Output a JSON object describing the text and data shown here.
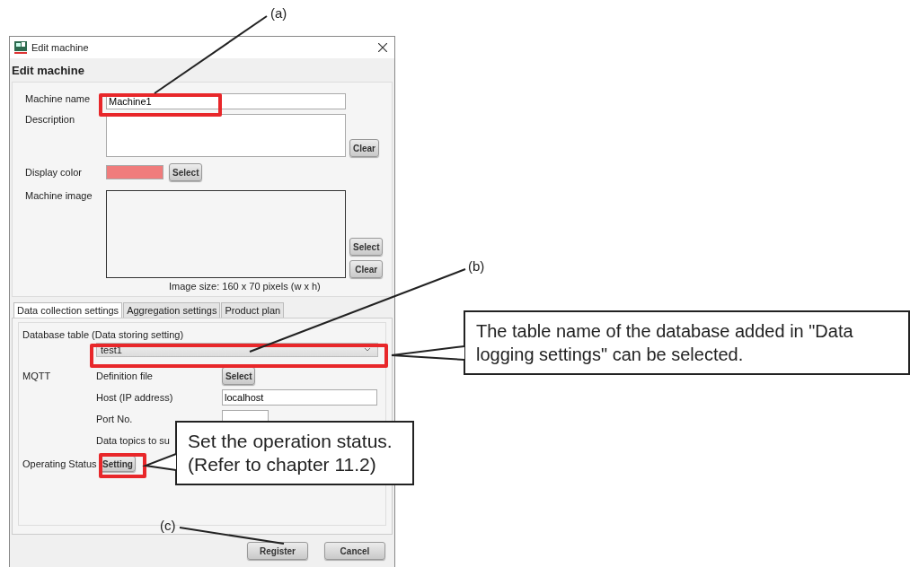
{
  "window": {
    "title": "Edit machine"
  },
  "header": "Edit machine",
  "machine": {
    "name_label": "Machine name",
    "name_value": "Machine1",
    "description_label": "Description",
    "description_clear": "Clear",
    "color_label": "Display color",
    "color": "#f07c7c",
    "color_select": "Select",
    "image_label": "Machine image",
    "image_select": "Select",
    "image_clear": "Clear",
    "image_size": "Image size: 160 x 70 pixels (w x h)"
  },
  "tabs": [
    {
      "label": "Data collection settings",
      "selected": true
    },
    {
      "label": "Aggregation settings",
      "selected": false
    },
    {
      "label": "Product plan",
      "selected": false
    }
  ],
  "data_collection": {
    "database_label": "Database table (Data storing setting)",
    "database_value": "test1",
    "mqtt_label": "MQTT",
    "definition_label": "Definition file",
    "definition_select": "Select",
    "host_label": "Host (IP address)",
    "host_value": "localhost",
    "port_label": "Port No.",
    "topics_label": "Data topics to su",
    "status_label": "Operating Status",
    "status_button": "Setting"
  },
  "buttons": [
    "Register",
    "Cancel"
  ],
  "annotations": [
    "(a)",
    "(b)",
    "(c)"
  ],
  "callouts": [
    {
      "lines": [
        "The table name of the database added in \"Data",
        "logging settings\" can be selected."
      ]
    },
    {
      "lines": [
        "Set the operation status.",
        "(Refer to chapter 11.2)"
      ]
    }
  ]
}
